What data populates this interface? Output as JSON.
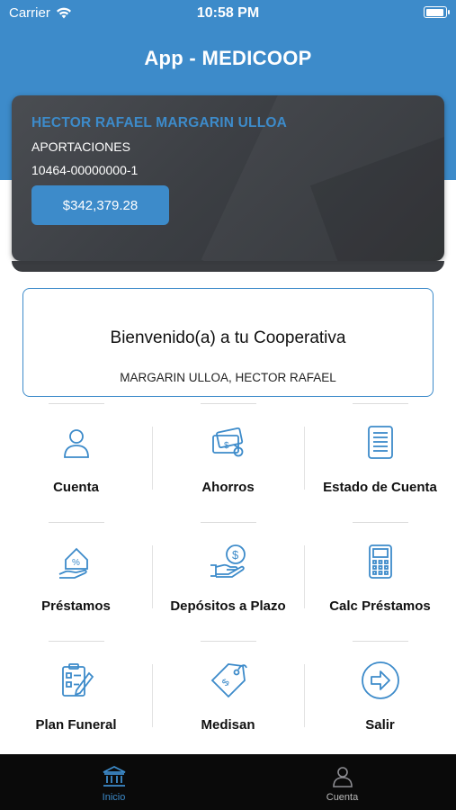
{
  "status_bar": {
    "carrier": "Carrier",
    "time": "10:58 PM"
  },
  "app": {
    "title": "App - MEDICOOP",
    "brand_color": "#3d8bca"
  },
  "account_card": {
    "holder_name": "HECTOR RAFAEL MARGARIN ULLOA",
    "product": "APORTACIONES",
    "account_number": "10464-00000000-1",
    "balance": "$342,379.28"
  },
  "welcome": {
    "title": "Bienvenido(a) a tu Cooperativa",
    "user": "MARGARIN ULLOA, HECTOR RAFAEL"
  },
  "menu": [
    {
      "label": "Cuenta",
      "icon": "person-icon"
    },
    {
      "label": "Ahorros",
      "icon": "money-bills-icon"
    },
    {
      "label": "Estado de Cuenta",
      "icon": "statement-icon"
    },
    {
      "label": "Préstamos",
      "icon": "house-percent-icon"
    },
    {
      "label": "Depósitos a Plazo",
      "icon": "hand-dollar-icon"
    },
    {
      "label": "Calc Préstamos",
      "icon": "calculator-icon"
    },
    {
      "label": "Plan Funeral",
      "icon": "checklist-pen-icon"
    },
    {
      "label": "Medisan",
      "icon": "price-tag-icon"
    },
    {
      "label": "Salir",
      "icon": "exit-arrow-icon"
    }
  ],
  "tabbar": {
    "tabs": [
      {
        "label": "Inicio",
        "icon": "bank-icon",
        "active": true
      },
      {
        "label": "Cuenta",
        "icon": "person-icon",
        "active": false
      }
    ]
  }
}
